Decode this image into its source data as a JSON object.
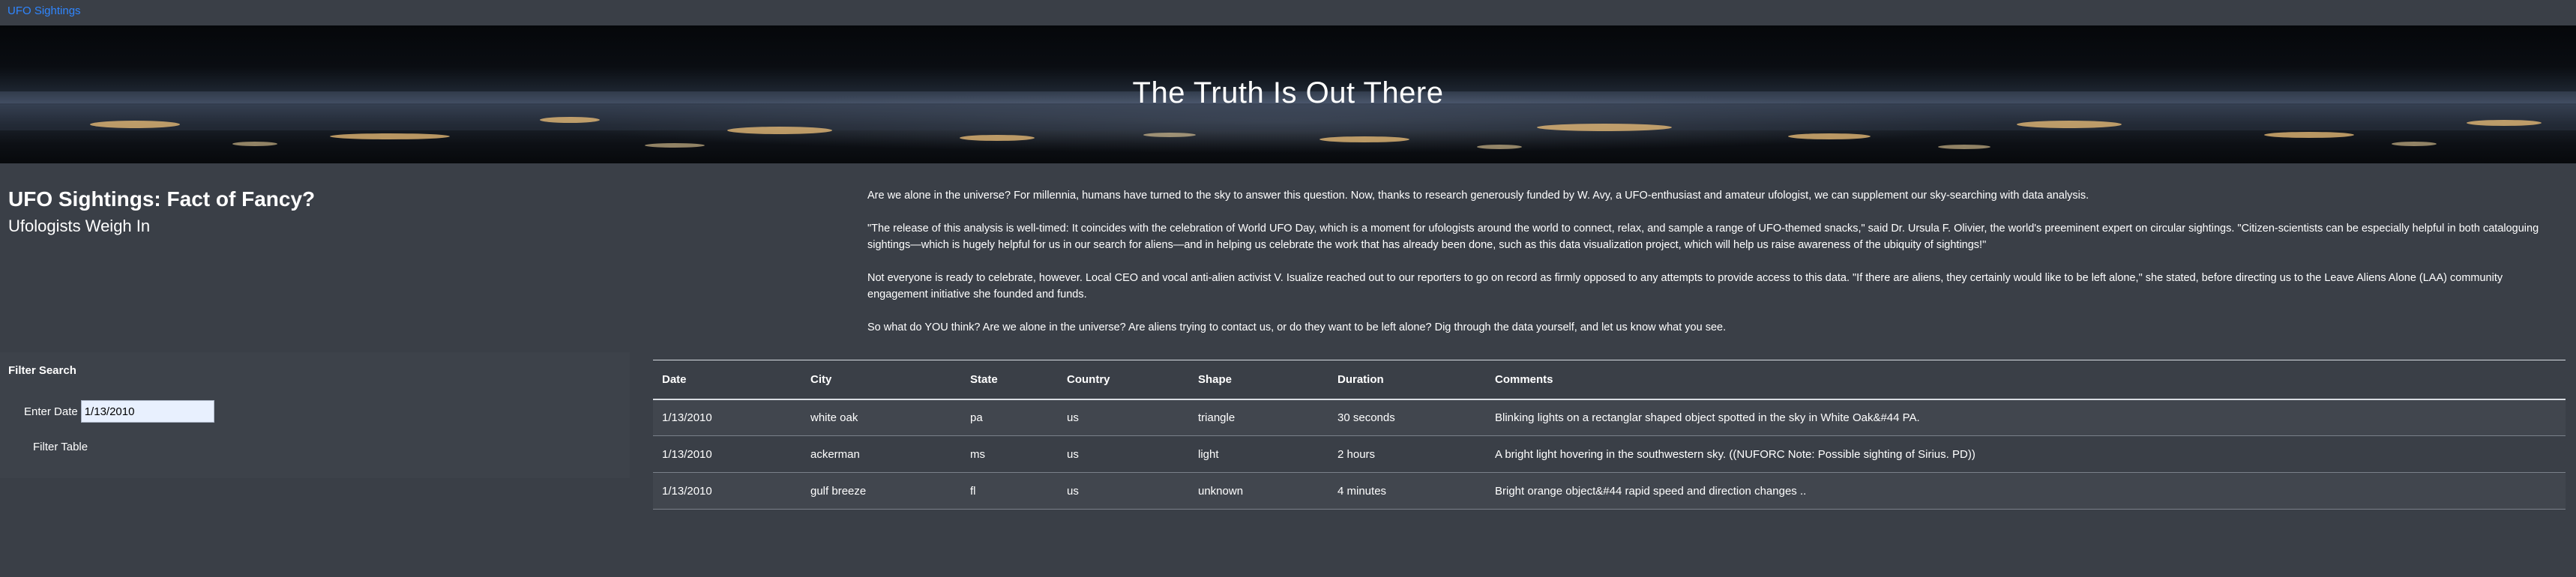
{
  "navbar": {
    "brand": "UFO Sightings"
  },
  "hero": {
    "title": "The Truth Is Out There"
  },
  "header": {
    "title": "UFO Sightings: Fact of Fancy?",
    "subtitle": "Ufologists Weigh In"
  },
  "article": {
    "paragraphs": [
      "Are we alone in the universe? For millennia, humans have turned to the sky to answer this question. Now, thanks to research generously funded by W. Avy, a UFO-enthusiast and amateur ufologist, we can supplement our sky-searching with data analysis.",
      "\"The release of this analysis is well-timed: It coincides with the celebration of World UFO Day, which is a moment for ufologists around the world to connect, relax, and sample a range of UFO-themed snacks,\" said Dr. Ursula F. Olivier, the world's preeminent expert on circular sightings. \"Citizen-scientists can be especially helpful in both cataloguing sightings—which is hugely helpful for us in our search for aliens—and in helping us celebrate the work that has already been done, such as this data visualization project, which will help us raise awareness of the ubiquity of sightings!\"",
      "Not everyone is ready to celebrate, however. Local CEO and vocal anti-alien activist V. Isualize reached out to our reporters to go on record as firmly opposed to any attempts to provide access to this data. \"If there are aliens, they certainly would like to be left alone,\" she stated, before directing us to the Leave Aliens Alone (LAA) community engagement initiative she founded and funds.",
      "So what do YOU think? Are we alone in the universe? Are aliens trying to contact us, or do they want to be left alone? Dig through the data yourself, and let us know what you see."
    ]
  },
  "filter": {
    "heading": "Filter Search",
    "date_label": "Enter Date",
    "date_value": "1/13/2010",
    "button_label": "Filter Table"
  },
  "table": {
    "columns": [
      "Date",
      "City",
      "State",
      "Country",
      "Shape",
      "Duration",
      "Comments"
    ],
    "rows": [
      [
        "1/13/2010",
        "white oak",
        "pa",
        "us",
        "triangle",
        "30 seconds",
        "Blinking lights on a rectanglar shaped object spotted in the sky in White Oak&#44 PA."
      ],
      [
        "1/13/2010",
        "ackerman",
        "ms",
        "us",
        "light",
        "2 hours",
        "A bright light hovering in the southwestern sky. ((NUFORC Note: Possible sighting of Sirius. PD))"
      ],
      [
        "1/13/2010",
        "gulf breeze",
        "fl",
        "us",
        "unknown",
        "4 minutes",
        "Bright orange object&#44 rapid speed and direction changes .."
      ]
    ]
  }
}
